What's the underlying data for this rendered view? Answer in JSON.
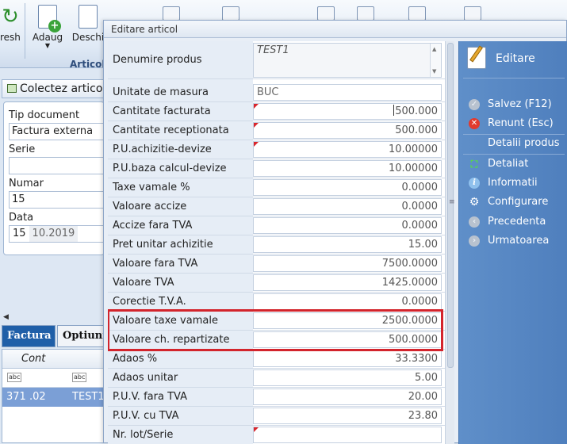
{
  "background": {
    "toolbar": {
      "refresh_label": "resh",
      "add_label": "Adaug",
      "open_label": "Deschi",
      "group_label": "Articol"
    },
    "panel_title": "Colectez artico",
    "form": {
      "doc_type_label": "Tip document",
      "doc_type_value": "Factura externa",
      "series_label": "Serie",
      "series_value": "",
      "number_label": "Numar",
      "number_value": "15",
      "date_label": "Data",
      "date_day": "15",
      "date_rest": "10.2019"
    },
    "tabs": [
      "Factura",
      "Optiuni"
    ],
    "grid": {
      "column_header": "Cont",
      "abc_label": "abc",
      "row_account": "371 .02",
      "row_item": "TEST1"
    }
  },
  "dialog": {
    "title": "Editare articol",
    "product_name_label": "Denumire produs",
    "product_name_value": "TEST1",
    "rows": [
      {
        "label": "Unitate de masura",
        "value": "BUC"
      },
      {
        "label": "Cantitate facturata",
        "value": "500.000"
      },
      {
        "label": "Cantitate receptionata",
        "value": "500.000"
      },
      {
        "label": "P.U.achizitie-devize",
        "value": "10.00000"
      },
      {
        "label": "P.U.baza calcul-devize",
        "value": "10.00000"
      },
      {
        "label": "Taxe vamale %",
        "value": "0.0000"
      },
      {
        "label": "Valoare accize",
        "value": "0.0000"
      },
      {
        "label": "Accize fara TVA",
        "value": "0.0000"
      },
      {
        "label": "Pret unitar achizitie",
        "value": "15.00"
      },
      {
        "label": "Valoare fara TVA",
        "value": "7500.0000"
      },
      {
        "label": "Valoare TVA",
        "value": "1425.0000"
      },
      {
        "label": "Corectie T.V.A.",
        "value": "0.0000"
      },
      {
        "label": "Valoare taxe vamale",
        "value": "2500.0000"
      },
      {
        "label": "Valoare ch. repartizate",
        "value": "500.0000"
      },
      {
        "label": "Adaos %",
        "value": "33.3300"
      },
      {
        "label": "Adaos unitar",
        "value": "5.00"
      },
      {
        "label": "P.U.V. fara TVA",
        "value": "20.00"
      },
      {
        "label": "P.U.V. cu TVA",
        "value": "23.80"
      },
      {
        "label": "Nr. lot/Serie",
        "value": ""
      }
    ],
    "highlight_color": "#d3242c"
  },
  "actions": {
    "header": "Editare",
    "items": [
      {
        "label": "Salvez (F12)",
        "icon": "save-icon"
      },
      {
        "label": "Renunt (Esc)",
        "icon": "cancel-icon"
      },
      {
        "label": "Detalii produs",
        "icon": ""
      },
      {
        "label": "Detaliat",
        "icon": "expand-icon"
      },
      {
        "label": "Informatii",
        "icon": "info-icon"
      },
      {
        "label": "Configurare",
        "icon": "gear-icon"
      },
      {
        "label": "Precedenta",
        "icon": "previous-icon"
      },
      {
        "label": "Urmatoarea",
        "icon": "next-icon"
      }
    ]
  }
}
